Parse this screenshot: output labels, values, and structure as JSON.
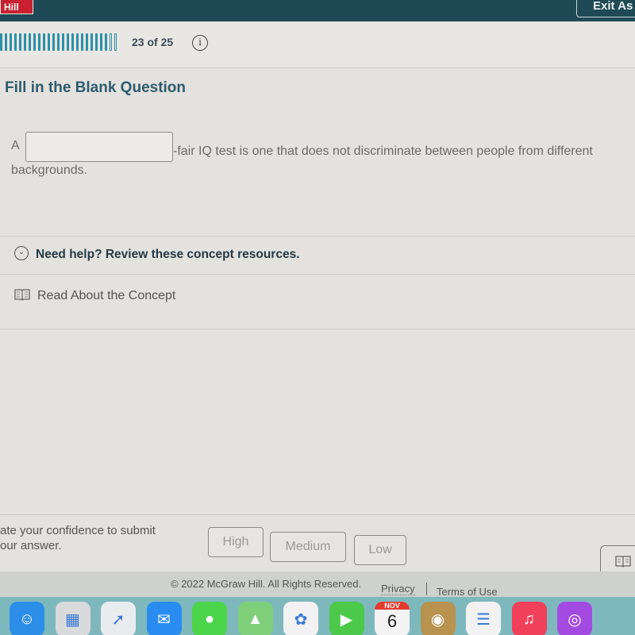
{
  "header": {
    "logo_text": "Hill",
    "exit_label": "Exit As"
  },
  "progress": {
    "current": 23,
    "total": 25,
    "label": "23 of 25",
    "info_icon": "info-icon"
  },
  "question": {
    "title": "Fill in the Blank Question",
    "prefix": "A",
    "blank_value": "",
    "suffix": "-fair IQ test is one that does not discriminate between people from different",
    "line2": "backgrounds."
  },
  "help": {
    "toggle_label": "Need help? Review these concept resources.",
    "toggle_icon": "chevron-down-circle-icon",
    "resources": [
      {
        "label": "Read About the Concept",
        "icon": "book-icon"
      }
    ]
  },
  "confidence": {
    "prompt": "ate your confidence to submit our answer.",
    "prompt_line1": "ate your confidence to submit",
    "prompt_line2": "our answer.",
    "buttons": [
      {
        "label": "High"
      },
      {
        "label": "Medium"
      },
      {
        "label": "Low"
      }
    ],
    "ebook_icon": "book-icon"
  },
  "footer": {
    "copyright": "© 2022 McGraw Hill. All Rights Reserved.",
    "privacy": "Privacy",
    "terms": "Terms of Use"
  },
  "dock": {
    "apps": [
      {
        "name": "Finder",
        "icon": "finder-icon",
        "color": "#2c8ee8"
      },
      {
        "name": "Launchpad",
        "icon": "launchpad-icon",
        "color": "#d8dadb"
      },
      {
        "name": "Safari",
        "icon": "safari-icon",
        "color": "#e9ecee"
      },
      {
        "name": "Mail",
        "icon": "mail-icon",
        "color": "#2a8cf0"
      },
      {
        "name": "Messages",
        "icon": "messages-icon",
        "color": "#4cd44a"
      },
      {
        "name": "Maps",
        "icon": "maps-icon",
        "color": "#7fcf7a"
      },
      {
        "name": "Photos",
        "icon": "photos-icon",
        "color": "#f2f2f2"
      },
      {
        "name": "FaceTime",
        "icon": "facetime-icon",
        "color": "#4cc94a"
      },
      {
        "name": "Calendar",
        "icon": "calendar-icon",
        "color": "#f4f4f4",
        "month": "NOV",
        "day": "6"
      },
      {
        "name": "Contacts",
        "icon": "contacts-icon",
        "color": "#b8924f"
      },
      {
        "name": "Reminders",
        "icon": "reminders-icon",
        "color": "#f2f2f2"
      },
      {
        "name": "Music",
        "icon": "music-icon",
        "color": "#f0405a"
      },
      {
        "name": "Podcasts",
        "icon": "podcasts-icon",
        "color": "#a34be0"
      }
    ]
  }
}
